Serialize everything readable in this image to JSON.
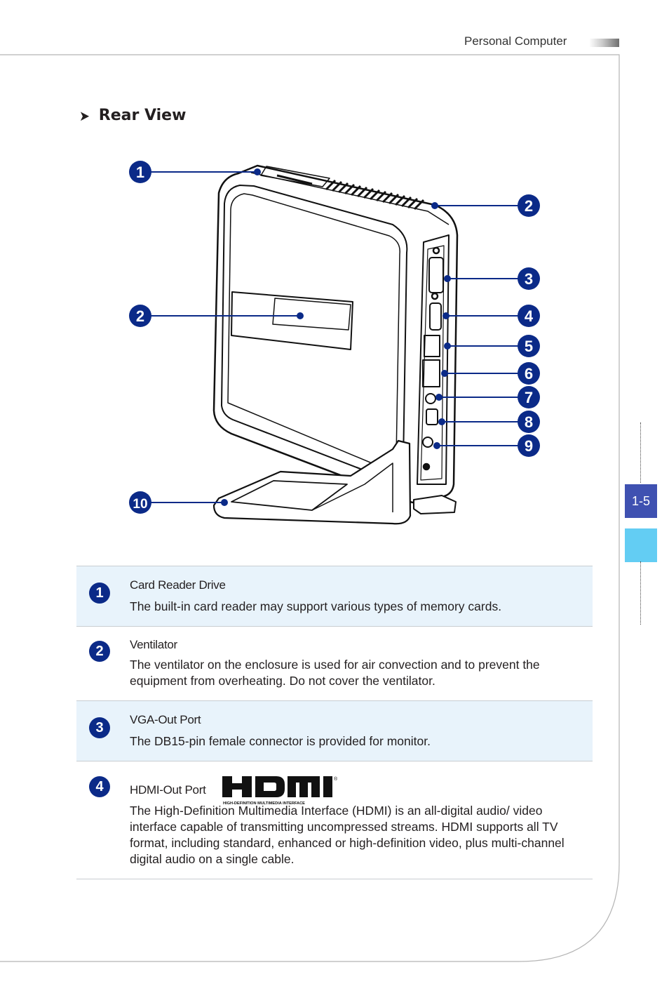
{
  "header": {
    "title": "Personal Computer"
  },
  "section": {
    "title": "Rear View",
    "bullet_icon": "chevron-right-icon"
  },
  "diagram": {
    "callouts": [
      "1",
      "2",
      "2",
      "3",
      "4",
      "5",
      "6",
      "7",
      "8",
      "9",
      "10"
    ],
    "callout_color": "#0b2a88"
  },
  "items": [
    {
      "number": "1",
      "title": "Card Reader Drive",
      "description": "The built-in card reader may support various types of memory cards."
    },
    {
      "number": "2",
      "title": "Ventilator",
      "description": "The ventilator on the enclosure is used for air convection and to prevent the equipment from overheating. Do not cover the ventilator."
    },
    {
      "number": "3",
      "title": "VGA-Out Port",
      "description": "The DB15-pin female connector is provided for monitor."
    },
    {
      "number": "4",
      "title": "HDMI-Out Port",
      "logo_text": "HDMI",
      "logo_subtext": "HIGH-DEFINITION MULTIMEDIA INTERFACE",
      "logo_mark": "®",
      "description": "The High-Definition Multimedia Interface (HDMI) is an all-digital audio/ video interface capable of transmitting uncompressed streams. HDMI supports all TV format, including standard, enhanced or high-definition video, plus multi-channel digital audio on a single cable."
    }
  ],
  "sidebar": {
    "page_number": "1-5",
    "accent_color": "#3f51b1",
    "highlight_color": "#63cdf3"
  }
}
